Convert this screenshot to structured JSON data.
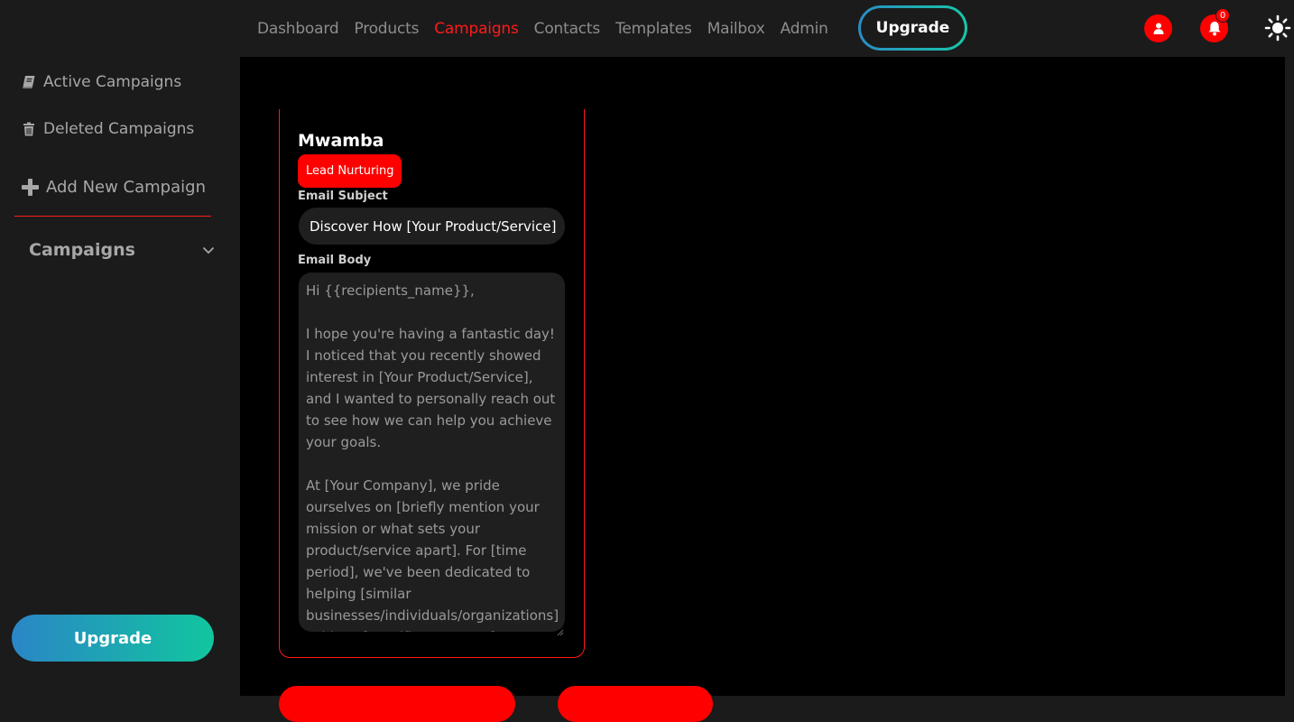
{
  "nav": {
    "links": [
      "Dashboard",
      "Products",
      "Campaigns",
      "Contacts",
      "Templates",
      "Mailbox",
      "Admin"
    ],
    "active": "Campaigns",
    "upgrade_label": "Upgrade",
    "notification_count": "0"
  },
  "sidebar": {
    "items": [
      {
        "label": "Active Campaigns",
        "icon": "book-icon"
      },
      {
        "label": "Deleted Campaigns",
        "icon": "trash-icon"
      },
      {
        "label": "Add New Campaign",
        "icon": "plus-icon"
      }
    ],
    "campaigns_label": "Campaigns",
    "upgrade_label": "Upgrade"
  },
  "campaign": {
    "name": "Mwamba",
    "tag": "Lead Nurturing",
    "subject_label": "Email Subject",
    "subject_value": "Discover How [Your Product/Service]",
    "body_label": "Email Body",
    "body_value": "Hi {{recipients_name}},\n\nI hope you're having a fantastic day! I noticed that you recently showed interest in [Your Product/Service], and I wanted to personally reach out to see how we can help you achieve your goals.\n\nAt [Your Company], we pride ourselves on [briefly mention your mission or what sets your product/service apart]. For [time period], we've been dedicated to helping [similar businesses/individuals/organizations] achieve [specific outcomes]."
  },
  "colors": {
    "accent": "#ff1a1a",
    "background": "#1b1b1b",
    "main_background": "#000000",
    "upgrade_gradient_start": "#2a86c6",
    "upgrade_gradient_end": "#11c69f"
  }
}
